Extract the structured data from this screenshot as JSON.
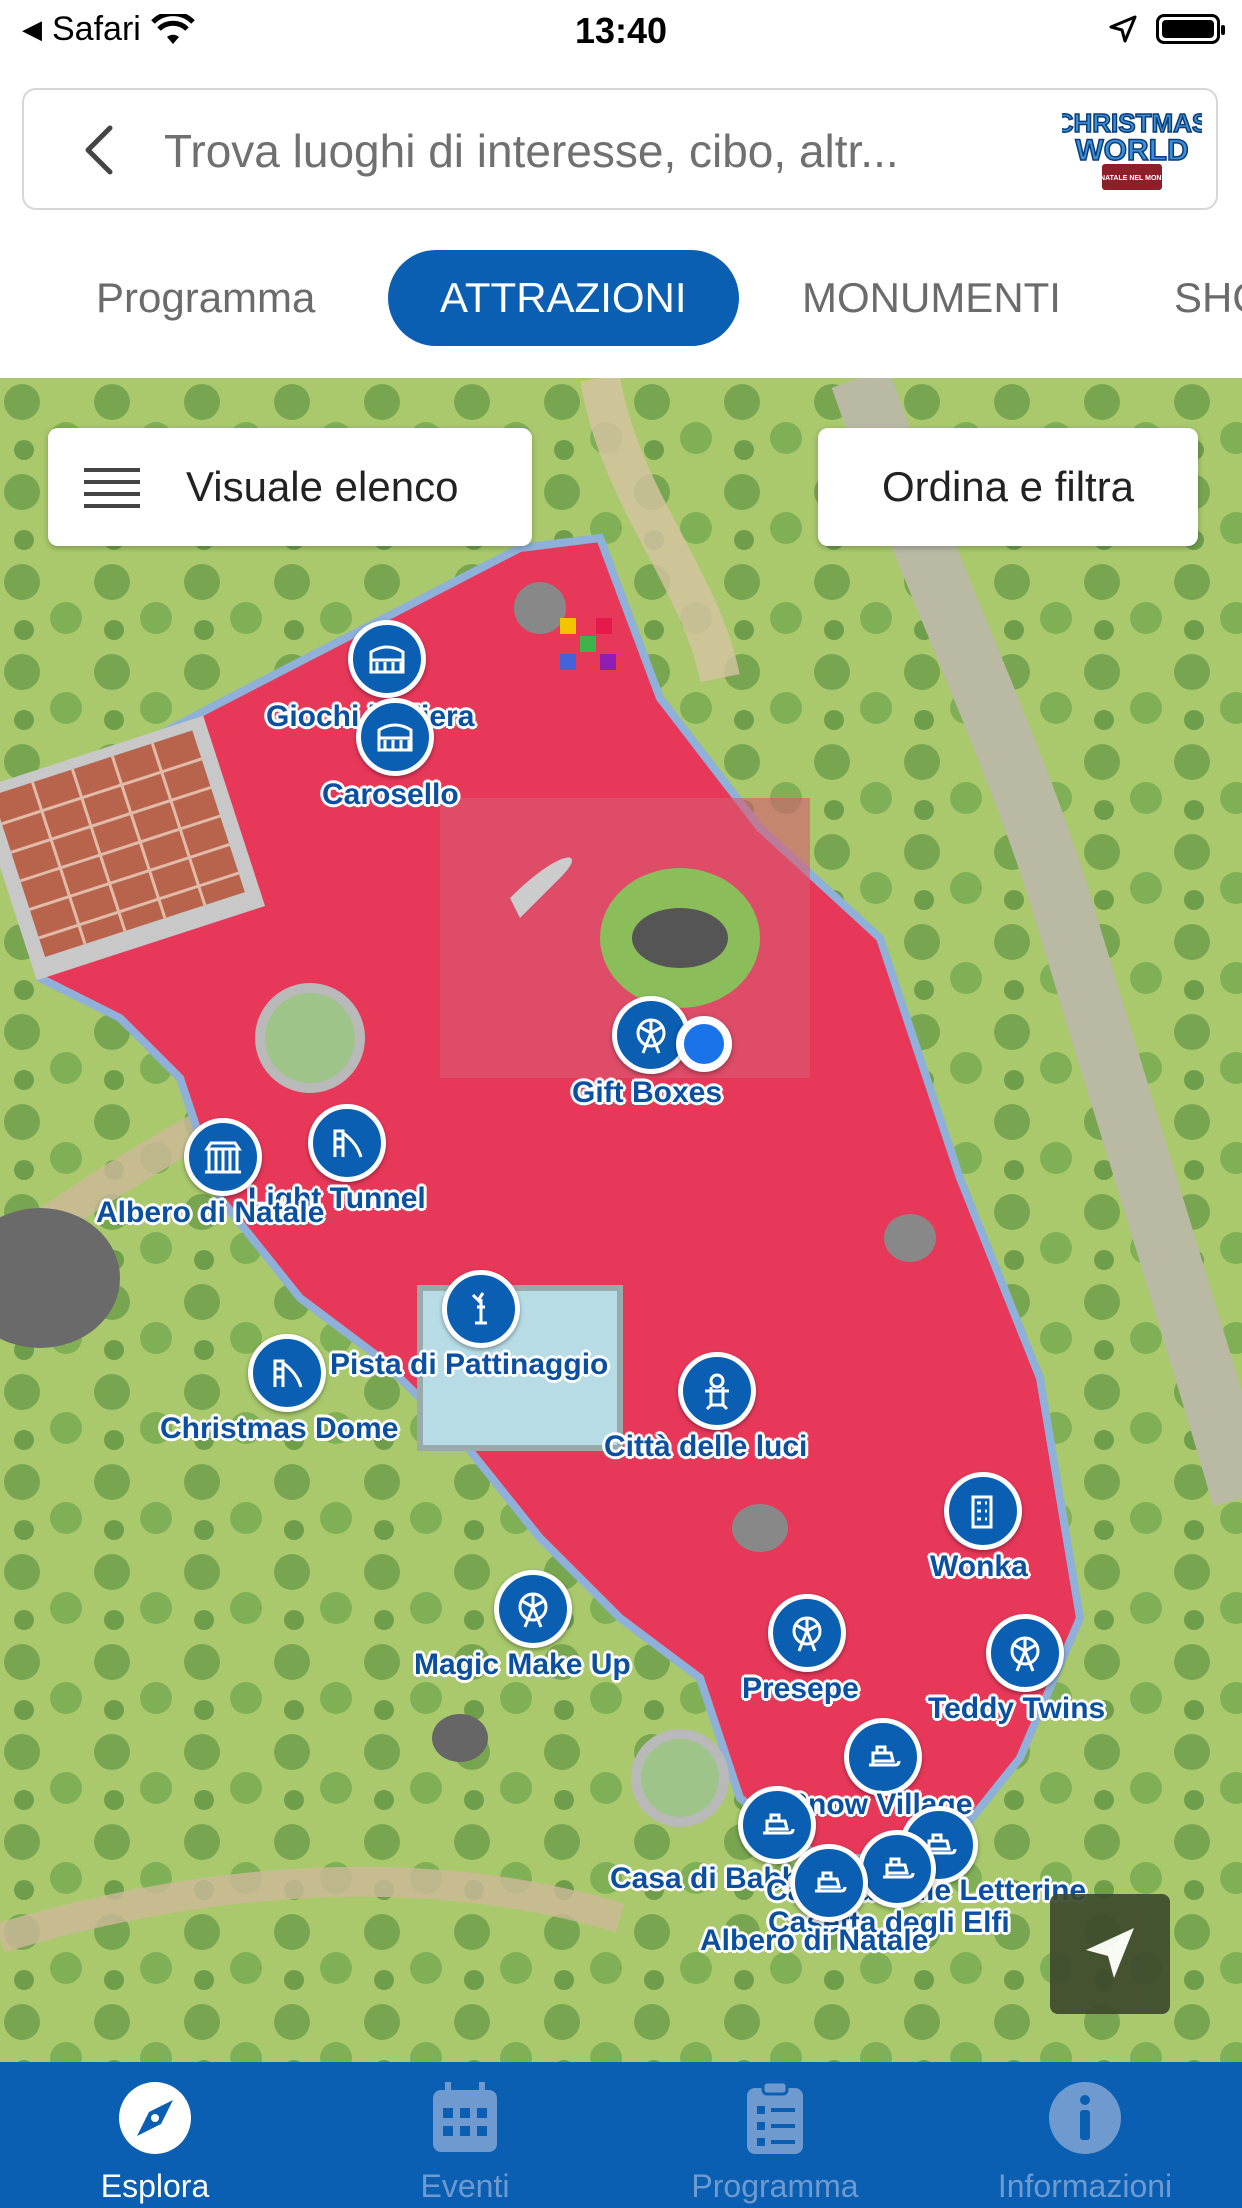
{
  "status_bar": {
    "back_app": "Safari",
    "time": "13:40"
  },
  "search": {
    "placeholder": "Trova luoghi di interesse, cibo, altr...",
    "back_icon": "chevron-left-icon",
    "logo_text_line1": "CHRISTMAS",
    "logo_text_line2": "WORLD",
    "logo_text_line3": "IL NATALE NEL MONDO"
  },
  "tabs": [
    {
      "label": "Programma",
      "active": false
    },
    {
      "label": "ATTRAZIONI",
      "active": true
    },
    {
      "label": "MONUMENTI",
      "active": false
    },
    {
      "label": "SHO",
      "active": false
    }
  ],
  "map": {
    "list_view_label": "Visuale elenco",
    "filter_label": "Ordina e filtra",
    "pois": [
      {
        "label": "Giochi in Fiera",
        "icon": "colosseum-icon"
      },
      {
        "label": "Carosello",
        "icon": "colosseum-icon"
      },
      {
        "label": "Gift Boxes",
        "icon": "ferris-wheel-icon"
      },
      {
        "label": "Light Tunnel",
        "icon": "slide-icon"
      },
      {
        "label": "Albero di Natale",
        "icon": "gate-monument-icon"
      },
      {
        "label": "Pista di Pattinaggio",
        "icon": "statue-of-liberty-icon"
      },
      {
        "label": "Christmas Dome",
        "icon": "slide-icon"
      },
      {
        "label": "Città delle luci",
        "icon": "gingerbread-icon"
      },
      {
        "label": "Wonka",
        "icon": "building-icon"
      },
      {
        "label": "Magic Make Up",
        "icon": "ferris-wheel-icon"
      },
      {
        "label": "Presepe",
        "icon": "ferris-wheel-icon"
      },
      {
        "label": "Teddy Twins",
        "icon": "ferris-wheel-icon"
      },
      {
        "label": "Snow Village",
        "icon": "sleigh-icon"
      },
      {
        "label": "Casa di Babbo Natale",
        "icon": "sleigh-icon"
      },
      {
        "label": "Casetta delle Letterine",
        "icon": "sleigh-icon"
      },
      {
        "label": "Casetta degli Elfi",
        "icon": "sleigh-icon"
      },
      {
        "label": "Albero di Natale",
        "icon": "sleigh-icon"
      }
    ]
  },
  "bottom_nav": [
    {
      "label": "Esplora",
      "icon": "compass-icon",
      "active": true
    },
    {
      "label": "Eventi",
      "icon": "calendar-icon",
      "active": false
    },
    {
      "label": "Programma",
      "icon": "clipboard-list-icon",
      "active": false
    },
    {
      "label": "Informazioni",
      "icon": "info-icon",
      "active": false
    }
  ],
  "colors": {
    "brand_blue": "#0a5fb3",
    "venue_red": "#e8385a",
    "grass": "#a9c96c",
    "user_dot": "#1a73e8"
  }
}
